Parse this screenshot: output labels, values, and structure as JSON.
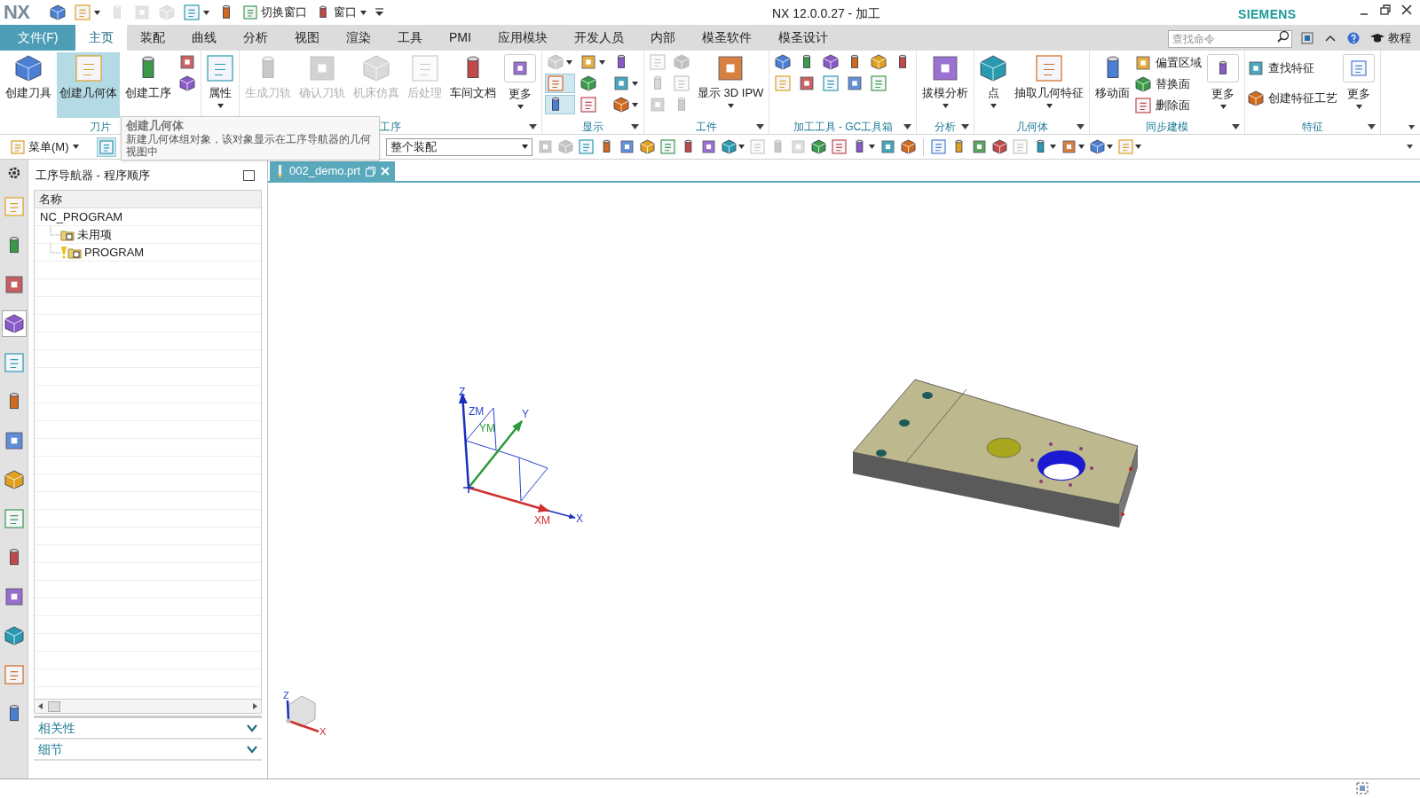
{
  "title_bar": {
    "logo": "NX",
    "title": "NX 12.0.0.27 - 加工",
    "brand": "SIEMENS",
    "quick_access": [
      {
        "kind": "icon",
        "disabled": false,
        "dropdown": false
      },
      {
        "kind": "icon",
        "disabled": false,
        "dropdown": true
      },
      {
        "kind": "icon",
        "disabled": true,
        "dropdown": false
      },
      {
        "kind": "icon",
        "disabled": true,
        "dropdown": false
      },
      {
        "kind": "icon",
        "disabled": true,
        "dropdown": false
      },
      {
        "kind": "icon",
        "disabled": false,
        "dropdown": true
      },
      {
        "kind": "icon",
        "disabled": false,
        "dropdown": false
      },
      {
        "kind": "button",
        "label": "切换窗口",
        "disabled": false,
        "dropdown": false
      },
      {
        "kind": "button",
        "label": "窗口",
        "disabled": false,
        "dropdown": true
      },
      {
        "kind": "menu",
        "disabled": false,
        "dropdown": true
      }
    ]
  },
  "menu_tabs": {
    "file": "文件(F)",
    "tabs": [
      {
        "label": "主页",
        "selected": true
      },
      {
        "label": "装配",
        "selected": false
      },
      {
        "label": "曲线",
        "selected": false
      },
      {
        "label": "分析",
        "selected": false
      },
      {
        "label": "视图",
        "selected": false
      },
      {
        "label": "渲染",
        "selected": false
      },
      {
        "label": "工具",
        "selected": false
      },
      {
        "label": "PMI",
        "selected": false
      },
      {
        "label": "应用模块",
        "selected": false
      },
      {
        "label": "开发人员",
        "selected": false
      },
      {
        "label": "内部",
        "selected": false
      },
      {
        "label": "模圣软件",
        "selected": false
      },
      {
        "label": "模圣设计",
        "selected": false
      }
    ],
    "search": {
      "placeholder": "查找命令"
    },
    "help_label": "教程"
  },
  "ribbon": {
    "groups": [
      {
        "label": "刀片",
        "menu": false,
        "items": [
          {
            "kind": "large",
            "label": "创建刀具",
            "disabled": false,
            "highlighted": false,
            "dropdown": false
          },
          {
            "kind": "large",
            "label": "创建几何体",
            "disabled": false,
            "highlighted": true,
            "dropdown": false
          },
          {
            "kind": "large",
            "label": "创建工序",
            "disabled": false,
            "highlighted": false,
            "dropdown": false
          },
          {
            "kind": "column",
            "icons": [
              {
                "disabled": false,
                "on": false,
                "dropdown": false
              },
              {
                "disabled": false,
                "on": false,
                "dropdown": false
              }
            ]
          }
        ]
      },
      {
        "menu": false,
        "items": [
          {
            "kind": "large",
            "label": "属性",
            "disabled": false,
            "highlighted": false,
            "dropdown": true
          }
        ]
      },
      {
        "label": "工序",
        "menu": true,
        "items": [
          {
            "kind": "large",
            "label": "生成刀轨",
            "disabled": true,
            "highlighted": false,
            "dropdown": false
          },
          {
            "kind": "large",
            "label": "确认刀轨",
            "disabled": true,
            "highlighted": false,
            "dropdown": false
          },
          {
            "kind": "large",
            "label": "机床仿真",
            "disabled": true,
            "highlighted": false,
            "dropdown": false
          },
          {
            "kind": "large",
            "label": "后处理",
            "disabled": true,
            "highlighted": false,
            "dropdown": false
          },
          {
            "kind": "large",
            "label": "车间文档",
            "disabled": false,
            "highlighted": false,
            "dropdown": false
          },
          {
            "kind": "more",
            "label": "更多"
          }
        ]
      },
      {
        "label": "显示",
        "menu": true,
        "items": [
          {
            "kind": "column",
            "icons": [
              {
                "disabled": true,
                "on": false,
                "dropdown": true
              },
              {
                "disabled": false,
                "on": true,
                "dropdown": false
              },
              {
                "disabled": false,
                "on": true,
                "dropdown": false
              }
            ]
          },
          {
            "kind": "column",
            "icons": [
              {
                "disabled": false,
                "on": false,
                "dropdown": true
              },
              {
                "disabled": false,
                "on": false,
                "dropdown": false
              },
              {
                "disabled": false,
                "on": false,
                "dropdown": false
              }
            ]
          },
          {
            "kind": "column",
            "icons": [
              {
                "disabled": false,
                "on": false,
                "dropdown": false
              },
              {
                "disabled": false,
                "on": false,
                "dropdown": true
              },
              {
                "disabled": false,
                "on": false,
                "dropdown": true
              }
            ]
          }
        ]
      },
      {
        "label": "工件",
        "menu": true,
        "items": [
          {
            "kind": "column",
            "icons": [
              {
                "disabled": true,
                "on": false,
                "dropdown": false
              },
              {
                "disabled": true,
                "on": false,
                "dropdown": false
              },
              {
                "disabled": true,
                "on": false,
                "dropdown": false
              }
            ]
          },
          {
            "kind": "column",
            "icons": [
              {
                "disabled": true,
                "on": false,
                "dropdown": false
              },
              {
                "disabled": true,
                "on": false,
                "dropdown": false
              },
              {
                "disabled": true,
                "on": false,
                "dropdown": false
              }
            ]
          },
          {
            "kind": "large",
            "label": "显示 3D IPW",
            "disabled": false,
            "highlighted": false,
            "dropdown": true
          }
        ]
      },
      {
        "label": "加工工具 - GC工具箱",
        "menu": true,
        "items": [
          {
            "kind": "column",
            "icons": [
              {
                "disabled": false,
                "on": false,
                "dropdown": false
              },
              {
                "disabled": false,
                "on": false,
                "dropdown": false
              }
            ]
          },
          {
            "kind": "column",
            "icons": [
              {
                "disabled": false,
                "on": false,
                "dropdown": false
              },
              {
                "disabled": false,
                "on": false,
                "dropdown": false
              }
            ]
          },
          {
            "kind": "column",
            "icons": [
              {
                "disabled": false,
                "on": false,
                "dropdown": false
              },
              {
                "disabled": false,
                "on": false,
                "dropdown": false
              }
            ]
          },
          {
            "kind": "column",
            "icons": [
              {
                "disabled": false,
                "on": false,
                "dropdown": false
              },
              {
                "disabled": false,
                "on": false,
                "dropdown": false
              }
            ]
          },
          {
            "kind": "column",
            "icons": [
              {
                "disabled": false,
                "on": false,
                "dropdown": false
              },
              {
                "disabled": false,
                "on": false,
                "dropdown": false
              }
            ]
          },
          {
            "kind": "column",
            "icons": [
              {
                "disabled": false,
                "on": false,
                "dropdown": false
              }
            ]
          }
        ]
      },
      {
        "label": "分析",
        "menu": true,
        "items": [
          {
            "kind": "large",
            "label": "拔模分析",
            "disabled": false,
            "highlighted": false,
            "dropdown": true
          }
        ]
      },
      {
        "label": "几何体",
        "menu": true,
        "items": [
          {
            "kind": "large",
            "label": "点",
            "disabled": false,
            "highlighted": false,
            "dropdown": true
          },
          {
            "kind": "large",
            "label": "抽取几何特征",
            "disabled": false,
            "highlighted": false,
            "dropdown": true
          }
        ]
      },
      {
        "label": "同步建模",
        "menu": true,
        "items": [
          {
            "kind": "large",
            "label": "移动面",
            "disabled": false,
            "highlighted": false,
            "dropdown": false
          },
          {
            "kind": "list",
            "entries": [
              "偏置区域",
              "替换面",
              "删除面"
            ]
          },
          {
            "kind": "more",
            "label": "更多"
          }
        ]
      },
      {
        "label": "特征",
        "menu": true,
        "items": [
          {
            "kind": "list",
            "entries": [
              "查找特征",
              "创建特征工艺"
            ]
          },
          {
            "kind": "more",
            "label": "更多"
          }
        ]
      }
    ]
  },
  "tooltip": {
    "title": "创建几何体",
    "text": "新建几何体组对象，该对象显示在工序导航器的几何视图中"
  },
  "toolbar": {
    "menu": "菜单(M)",
    "scope": "整个装配",
    "icons": [
      {
        "disabled": true,
        "dropdown": false
      },
      {
        "disabled": true,
        "dropdown": false
      },
      {
        "disabled": false,
        "dropdown": false
      },
      {
        "disabled": false,
        "dropdown": false
      },
      {
        "disabled": false,
        "dropdown": false
      },
      {
        "disabled": false,
        "dropdown": false
      },
      {
        "disabled": false,
        "dropdown": false
      },
      {
        "disabled": false,
        "dropdown": false
      },
      {
        "disabled": false,
        "dropdown": false
      },
      {
        "disabled": false,
        "dropdown": true
      },
      {
        "disabled": true,
        "dropdown": false
      },
      {
        "disabled": true,
        "dropdown": false
      },
      {
        "disabled": true,
        "dropdown": false
      },
      {
        "disabled": false,
        "dropdown": false
      },
      {
        "disabled": false,
        "dropdown": false
      },
      {
        "disabled": false,
        "dropdown": true
      },
      {
        "disabled": false,
        "dropdown": false
      },
      {
        "disabled": false,
        "dropdown": false
      },
      {
        "disabled": false,
        "dropdown": false
      },
      {
        "disabled": false,
        "dropdown": false
      },
      {
        "disabled": false,
        "dropdown": false
      },
      {
        "disabled": false,
        "dropdown": false
      },
      {
        "disabled": true,
        "dropdown": false
      },
      {
        "disabled": false,
        "dropdown": true
      },
      {
        "disabled": false,
        "dropdown": true
      },
      {
        "disabled": false,
        "dropdown": true
      },
      {
        "disabled": false,
        "dropdown": true
      }
    ]
  },
  "resource_bar": {
    "items": [
      {
        "selected": false
      },
      {
        "selected": false
      },
      {
        "selected": false
      },
      {
        "selected": true
      },
      {
        "selected": false
      },
      {
        "selected": false
      },
      {
        "selected": false
      },
      {
        "selected": false
      },
      {
        "selected": false
      },
      {
        "selected": false
      },
      {
        "selected": false
      },
      {
        "selected": false
      },
      {
        "selected": false
      },
      {
        "selected": false
      }
    ]
  },
  "navigator": {
    "title": "工序导航器 - 程序顺序",
    "column": "名称",
    "rows": [
      {
        "label": "NC_PROGRAM",
        "warning": false,
        "children": [
          {
            "label": "未用项",
            "warning": false
          },
          {
            "label": "PROGRAM",
            "warning": true
          }
        ]
      }
    ],
    "sections": [
      {
        "label": "相关性",
        "expanded": false
      },
      {
        "label": "细节",
        "expanded": false
      }
    ]
  },
  "graphics": {
    "tab": {
      "label": "002_demo.prt",
      "selected": true
    },
    "wcs_labels": [
      "Z",
      "ZM",
      "YM",
      "Y",
      "XM",
      "X"
    ],
    "view_triad_labels": [
      "Z",
      "X"
    ]
  }
}
